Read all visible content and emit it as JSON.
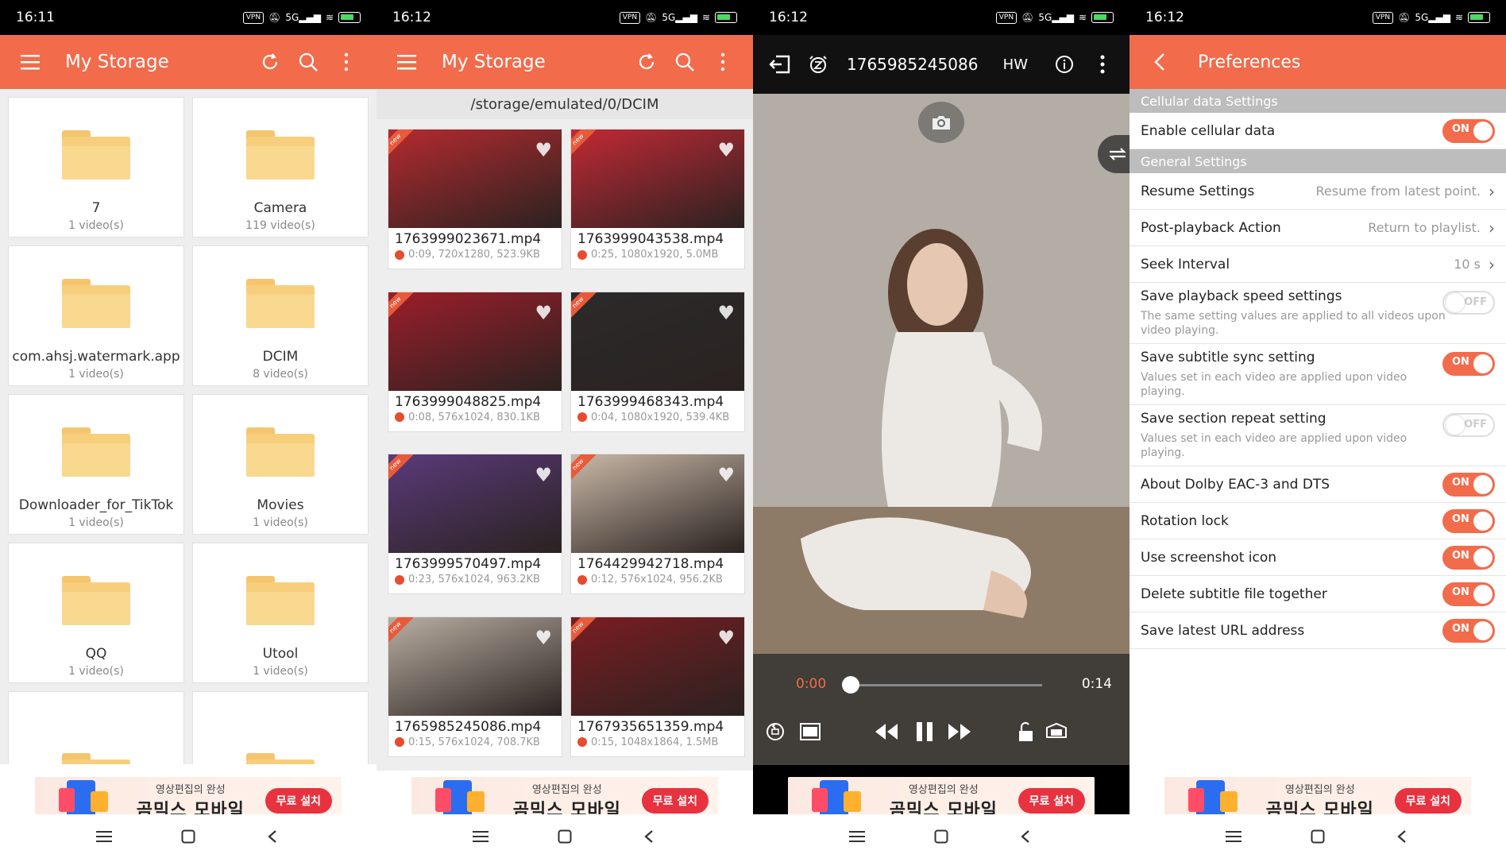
{
  "status": {
    "p1_time": "16:11",
    "p2_time": "16:12",
    "p3_time": "16:12",
    "p4_time": "16:12",
    "vpn": "VPN",
    "signal": "5G"
  },
  "ad": {
    "small": "영상편집의 완성",
    "big": "곰믹스 모바일",
    "button": "무료 설치"
  },
  "panel1": {
    "title": "My Storage",
    "folders": [
      {
        "name": "7",
        "count": "1 video(s)"
      },
      {
        "name": "Camera",
        "count": "119 video(s)"
      },
      {
        "name": "com.ahsj.watermark.app",
        "count": "1 video(s)"
      },
      {
        "name": "DCIM",
        "count": "8 video(s)"
      },
      {
        "name": "Downloader_for_TikTok",
        "count": "1 video(s)"
      },
      {
        "name": "Movies",
        "count": "1 video(s)"
      },
      {
        "name": "QQ",
        "count": "1 video(s)"
      },
      {
        "name": "Utool",
        "count": "1 video(s)"
      },
      {
        "name": "",
        "count": ""
      },
      {
        "name": "",
        "count": ""
      }
    ]
  },
  "panel2": {
    "title": "My Storage",
    "path": "/storage/emulated/0/DCIM",
    "new_tag": "new",
    "videos": [
      {
        "name": "1763999023671.mp4",
        "meta": "0:09, 720x1280, 523.9KB",
        "color": "#b52a2f"
      },
      {
        "name": "1763999043538.mp4",
        "meta": "0:25, 1080x1920, 5.0MB",
        "color": "#c22935"
      },
      {
        "name": "1763999048825.mp4",
        "meta": "0:08, 576x1024, 830.1KB",
        "color": "#9c1e2a"
      },
      {
        "name": "1763999468343.mp4",
        "meta": "0:04, 1080x1920, 539.4KB",
        "color": "#2c2a2b"
      },
      {
        "name": "1763999570497.mp4",
        "meta": "0:23, 576x1024, 963.2KB",
        "color": "#5a3a7a"
      },
      {
        "name": "1764429942718.mp4",
        "meta": "0:12, 576x1024, 956.2KB",
        "color": "#c9b8a7"
      },
      {
        "name": "1765985245086.mp4",
        "meta": "0:15, 576x1024, 708.7KB",
        "color": "#b9aea2"
      },
      {
        "name": "1767935651359.mp4",
        "meta": "0:15, 1048x1864, 1.5MB",
        "color": "#7a1d22"
      }
    ]
  },
  "panel3": {
    "title": "1765985245086",
    "hw": "HW",
    "current_time": "0:00",
    "total_time": "0:14",
    "progress": 0.0
  },
  "panel4": {
    "title": "Preferences",
    "sections": [
      {
        "header": "Cellular data Settings"
      },
      {
        "header": "General Settings"
      }
    ],
    "rows": {
      "cellular": {
        "label": "Enable cellular data",
        "state": "ON"
      },
      "resume": {
        "label": "Resume Settings",
        "value": "Resume from latest point."
      },
      "post": {
        "label": "Post-playback Action",
        "value": "Return to playlist."
      },
      "seek": {
        "label": "Seek Interval",
        "value": "10 s"
      },
      "speed": {
        "label": "Save playback speed settings",
        "desc": "The same setting values are applied to all videos upon video playing.",
        "state": "OFF"
      },
      "subtitle": {
        "label": "Save subtitle sync setting",
        "desc": "Values set in each video are applied upon video playing.",
        "state": "ON"
      },
      "section": {
        "label": "Save section repeat setting",
        "desc": "Values set in each video are applied upon video playing.",
        "state": "OFF"
      },
      "dolby": {
        "label": "About Dolby EAC-3 and DTS",
        "state": "ON"
      },
      "rotation": {
        "label": "Rotation lock",
        "state": "ON"
      },
      "screenshot": {
        "label": "Use screenshot icon",
        "state": "ON"
      },
      "delsub": {
        "label": "Delete subtitle file together",
        "state": "ON"
      },
      "url": {
        "label": "Save latest URL address",
        "state": "ON"
      }
    }
  },
  "colors": {
    "accent": "#f26b4b",
    "folder": "#f7cf7c"
  }
}
